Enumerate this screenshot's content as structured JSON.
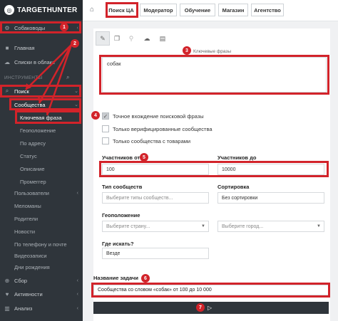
{
  "brand": {
    "name": "TARGETHUNTER",
    "logo_icon": "target-logo-icon"
  },
  "sidebar": {
    "top_item": "Собаководы",
    "items": [
      "Главная",
      "Списки в облаке"
    ],
    "section_label": "ИНСТРУМЕНТЫ",
    "search_item": "Поиск",
    "communities": "Сообщества",
    "keyword_phrase": "Ключевая фраза",
    "sub_items": [
      "Геоположение",
      "По адресу",
      "Статус",
      "Описание",
      "Промеггер"
    ],
    "tool_items": [
      "Пользователи",
      "Меломаны",
      "Родители",
      "Новости",
      "По телефону и почте",
      "Видеозаписи",
      "Дни рождения"
    ],
    "bottom_items": [
      "Сбор",
      "Активности",
      "Анализ"
    ]
  },
  "topbar": {
    "tabs": [
      "Поиск ЦА",
      "Модератор",
      "Обучение",
      "Магазин",
      "Агентство"
    ]
  },
  "form": {
    "keywords_label": "Ключевые фразы",
    "keywords_value": "собак",
    "checkboxes": [
      {
        "label": "Точное вхождение поисковой фразы",
        "checked": true
      },
      {
        "label": "Только верифицированные сообщества",
        "checked": false
      },
      {
        "label": "Только сообщества с товарами",
        "checked": false
      }
    ],
    "members_from_label": "Участников от",
    "members_from_value": "100",
    "members_to_label": "Участников до",
    "members_to_value": "10000",
    "community_type_label": "Тип сообществ",
    "community_type_placeholder": "Выберите типы сообществ...",
    "sort_label": "Сортировка",
    "sort_value": "Без сортировки",
    "geo_label": "Геоположение",
    "country_placeholder": "Выберите страну...",
    "city_placeholder": "Выберите город...",
    "where_label": "Где искать?",
    "where_value": "Везде",
    "task_label": "Название задачи",
    "task_value": "Сообщества со словом «собак» от 100 до 10 000"
  },
  "badges": [
    "1",
    "2",
    "3",
    "4",
    "5",
    "6",
    "7"
  ],
  "colors": {
    "annotation": "#d2232a",
    "sidebar": "#2f353b",
    "run_bar": "#2f353b"
  }
}
